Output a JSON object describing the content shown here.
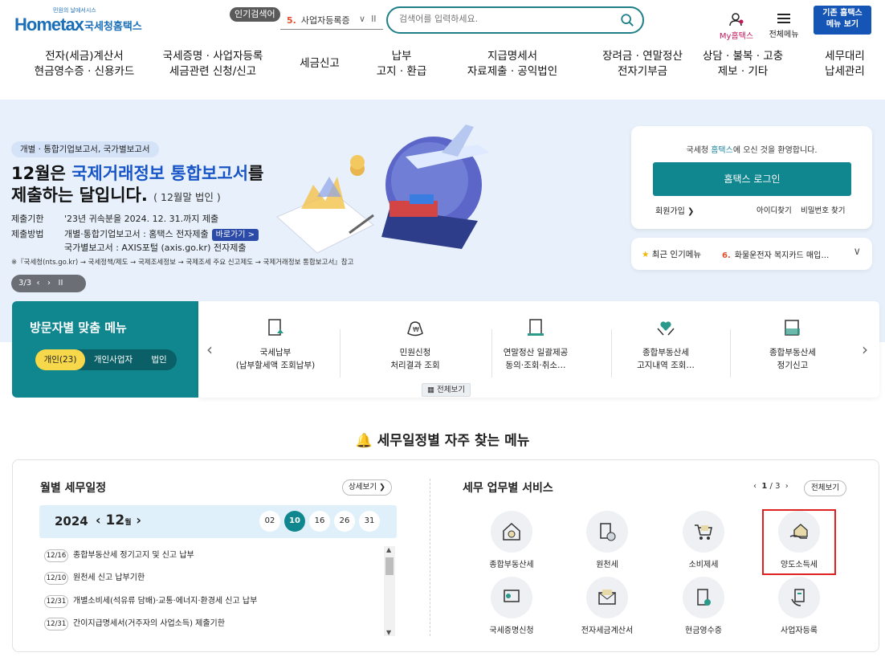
{
  "header": {
    "logo_tagline": "민원의 날에서시스",
    "logo_text": "Hometax",
    "logo_kr": "국세청홈택스",
    "popular_tag": "인기검색어",
    "popular_rank": "5.",
    "popular_term": "사업자등록증",
    "search_placeholder": "검색어를 입력하세요.",
    "my_hometax": "My홈택스",
    "all_menu": "전체메뉴",
    "classic_line1": "기존 홈택스",
    "classic_line2": "메뉴 보기"
  },
  "gnb": [
    {
      "l1": "전자(세금)계산서",
      "l2": "현금영수증 · 신용카드"
    },
    {
      "l1": "국세증명 · 사업자등록",
      "l2": "세금관련 신청/신고"
    },
    {
      "l1": "세금신고",
      "l2": ""
    },
    {
      "l1": "납부",
      "l2": "고지 · 환급"
    },
    {
      "l1": "지급명세서",
      "l2": "자료제출 · 공익법인"
    },
    {
      "l1": "장려금 · 연말정산",
      "l2": "전자기부금"
    },
    {
      "l1": "상담 · 불복 · 고충",
      "l2": "제보 · 기타"
    },
    {
      "l1": "세무대리",
      "l2": "납세관리"
    }
  ],
  "hero": {
    "tag": "개별 · 통합기업보고서, 국가별보고서",
    "title_a": "12월은 ",
    "title_hl": "국제거래정보 통합보고서",
    "title_b": "를",
    "title_line2": "제출하는 달입니다.",
    "title_sub": "( 12월말 법인 )",
    "row1_key": "제출기한",
    "row1_val": "'23년 귀속분을 2024. 12. 31.까지 제출",
    "row2_key": "제출방법",
    "row2_val": "개별·통합기업보고서 : 홈택스 전자제출",
    "goto": "바로가기 >",
    "row3_val": "국가별보고서 : AXIS포털 (axis.go.kr) 전자제출",
    "note": "※『국세청(nts.go.kr) → 국세정책/제도 → 국제조세정보 → 국제조세 주요 신고제도 → 국제거래정보 통합보고서』참고",
    "slide": "3/3"
  },
  "login": {
    "welcome_a": "국세청 ",
    "welcome_b": "홈택스",
    "welcome_c": "에 오신 것을 환영합니다.",
    "button": "홈택스 로그인",
    "join": "회원가입 ❯",
    "find_id": "아이디찾기",
    "find_pw": "비밀번호 찾기"
  },
  "popular_menu": {
    "label": "최근 인기메뉴",
    "rank": "6.",
    "item": "화물운전자 복지카드 매입…"
  },
  "visitor": {
    "title": "방문자별 맞춤 메뉴",
    "tabs": [
      "개인(23)",
      "개인사업자",
      "법인"
    ],
    "items": [
      {
        "l1": "국세납부",
        "l2": "(납부할세액 조회납부)"
      },
      {
        "l1": "민원신청",
        "l2": "처리결과 조회"
      },
      {
        "l1": "연말정산 일괄제공",
        "l2": "동의·조회·취소…"
      },
      {
        "l1": "종합부동산세",
        "l2": "고지내역 조회…"
      },
      {
        "l1": "종합부동산세",
        "l2": "정기신고"
      }
    ],
    "all_view": "전체보기"
  },
  "section_title": "세무일정별 자주 찾는 메뉴",
  "monthly": {
    "title": "월별 세무일정",
    "detail": "상세보기 ❯",
    "year": "2024",
    "month": "12",
    "month_unit": "월",
    "days": [
      "02",
      "10",
      "16",
      "26",
      "31"
    ],
    "selected_day": "10",
    "schedule": [
      {
        "date": "12/16",
        "text": "종합부동산세 정기고지 및 신고 납부"
      },
      {
        "date": "12/10",
        "text": "원천세 신고 납부기한"
      },
      {
        "date": "12/31",
        "text": "개별소비세(석유류 담배)·교통·에너지·환경세 신고 납부"
      },
      {
        "date": "12/31",
        "text": "간이지급명세서(거주자의 사업소득) 제출기한"
      }
    ]
  },
  "services": {
    "title": "세무 업무별 서비스",
    "page": "1",
    "page_total": "/ 3",
    "all": "전체보기",
    "items": [
      "종합부동산세",
      "원천세",
      "소비제세",
      "양도소득세",
      "국세증명신청",
      "전자세금계산서",
      "현금영수증",
      "사업자등록"
    ],
    "highlighted": "양도소득세"
  },
  "colors": {
    "teal": "#10868f",
    "blue": "#1855c6",
    "highlight": "#e0201e"
  }
}
